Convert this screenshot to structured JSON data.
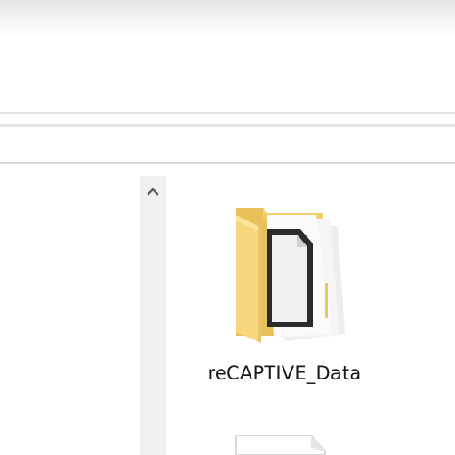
{
  "window": {
    "type": "file-explorer"
  },
  "files": [
    {
      "name": "reCAPTIVE_Data",
      "icon": "folder-with-document-icon"
    },
    {
      "name": "",
      "icon": "document-icon"
    }
  ],
  "scrollbar": {
    "up_icon": "chevron-up-icon"
  },
  "colors": {
    "folder_yellow": "#f7d878",
    "scrollbar_bg": "#f0f0f0"
  }
}
